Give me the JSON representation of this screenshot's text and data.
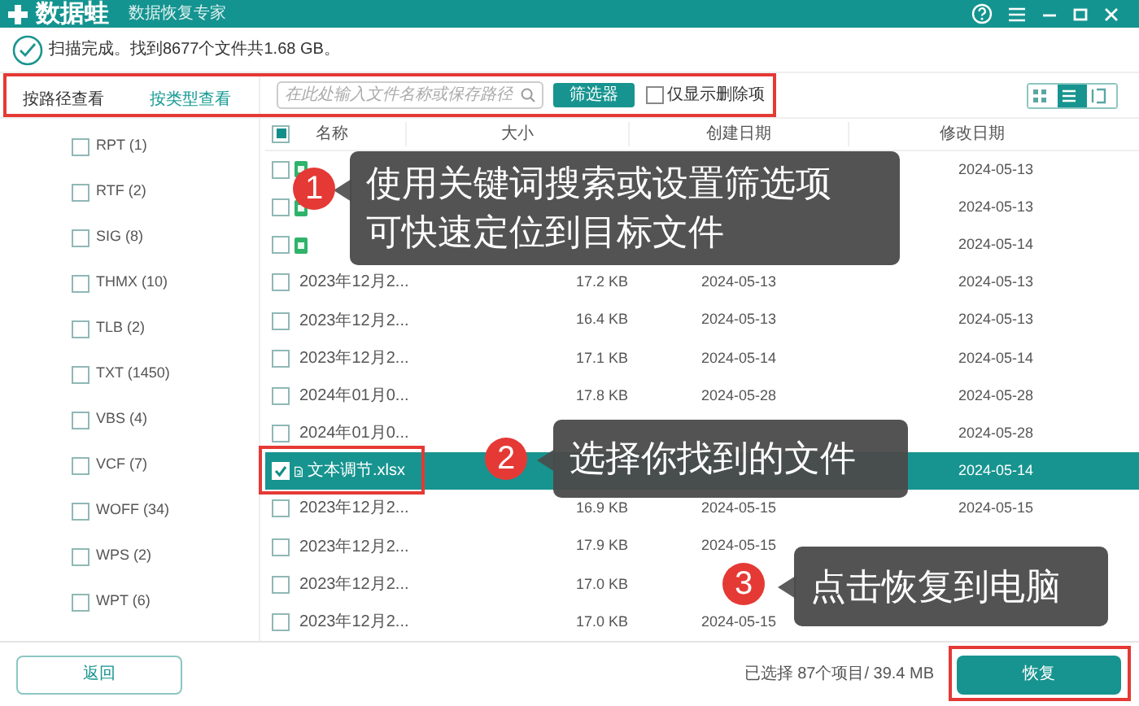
{
  "app": {
    "name": "数据蛙",
    "subtitle": "数据恢复专家"
  },
  "status": {
    "text": "扫描完成。找到8677个文件共1.68 GB。"
  },
  "toolbar": {
    "highlighted": true,
    "view_tabs": [
      {
        "label": "按路径查看",
        "selected": false
      },
      {
        "label": "按类型查看",
        "selected": true
      }
    ],
    "search": {
      "placeholder": "在此处输入文件名称或保存路径"
    },
    "filter_button": "筛选器",
    "deleted_only": {
      "label": "仅显示删除项",
      "checked": false
    },
    "view_modes": [
      {
        "kind": "grid",
        "selected": false
      },
      {
        "kind": "list",
        "selected": true
      },
      {
        "kind": "columns",
        "selected": false
      }
    ]
  },
  "sidebar": {
    "items": [
      {
        "label": "RPT (1)",
        "checked": false
      },
      {
        "label": "RTF (2)",
        "checked": false
      },
      {
        "label": "SIG (8)",
        "checked": false
      },
      {
        "label": "THMX (10)",
        "checked": false
      },
      {
        "label": "TLB (2)",
        "checked": false
      },
      {
        "label": "TXT (1450)",
        "checked": false
      },
      {
        "label": "VBS (4)",
        "checked": false
      },
      {
        "label": "VCF (7)",
        "checked": false
      },
      {
        "label": "WOFF (34)",
        "checked": false
      },
      {
        "label": "WPS (2)",
        "checked": false
      },
      {
        "label": "WPT (6)",
        "checked": false
      }
    ]
  },
  "table": {
    "select_all": {
      "partial": true
    },
    "columns": [
      "名称",
      "大小",
      "创建日期",
      "修改日期"
    ],
    "rows": [
      {
        "checked": false,
        "selected": false,
        "modified": "2024-05-13"
      },
      {
        "checked": false,
        "selected": false,
        "modified": "2024-05-13"
      },
      {
        "checked": false,
        "selected": false,
        "modified": "2024-05-14"
      },
      {
        "checked": false,
        "selected": false,
        "name": "2023年12月2...",
        "size": "17.2 KB",
        "created": "2024-05-13",
        "modified": "2024-05-13"
      },
      {
        "checked": false,
        "selected": false,
        "name": "2023年12月2...",
        "size": "16.4 KB",
        "created": "2024-05-13",
        "modified": "2024-05-13"
      },
      {
        "checked": false,
        "selected": false,
        "name": "2023年12月2...",
        "size": "17.1 KB",
        "created": "2024-05-14",
        "modified": "2024-05-14"
      },
      {
        "checked": false,
        "selected": false,
        "name": "2024年01月0...",
        "size": "17.8 KB",
        "created": "2024-05-28",
        "modified": "2024-05-28"
      },
      {
        "checked": false,
        "selected": false,
        "name": "2024年01月0...",
        "modified": "2024-05-28"
      },
      {
        "checked": true,
        "selected": true,
        "highlighted": true,
        "name": "文本调节.xlsx",
        "modified": "2024-05-14"
      },
      {
        "checked": false,
        "selected": false,
        "name": "2023年12月2...",
        "size": "16.9 KB",
        "created": "2024-05-15",
        "modified": "2024-05-15"
      },
      {
        "checked": false,
        "selected": false,
        "name": "2023年12月2...",
        "size": "17.9 KB",
        "created": "2024-05-15"
      },
      {
        "checked": false,
        "selected": false,
        "name": "2023年12月2...",
        "size": "17.0 KB"
      },
      {
        "checked": false,
        "selected": false,
        "name": "2023年12月2...",
        "size": "17.0 KB",
        "created": "2024-05-15"
      }
    ]
  },
  "footer": {
    "back_button": "返回",
    "selection_info": "已选择 87个项目/ 39.4 MB",
    "recover_button": {
      "label": "恢复",
      "highlighted": true
    }
  },
  "callouts": [
    {
      "number": "1",
      "lines": [
        "使用关键词搜索或设置筛选项",
        "可快速定位到目标文件"
      ]
    },
    {
      "number": "2",
      "lines": [
        "选择你找到的文件"
      ]
    },
    {
      "number": "3",
      "lines": [
        "点击恢复到电脑"
      ]
    }
  ]
}
